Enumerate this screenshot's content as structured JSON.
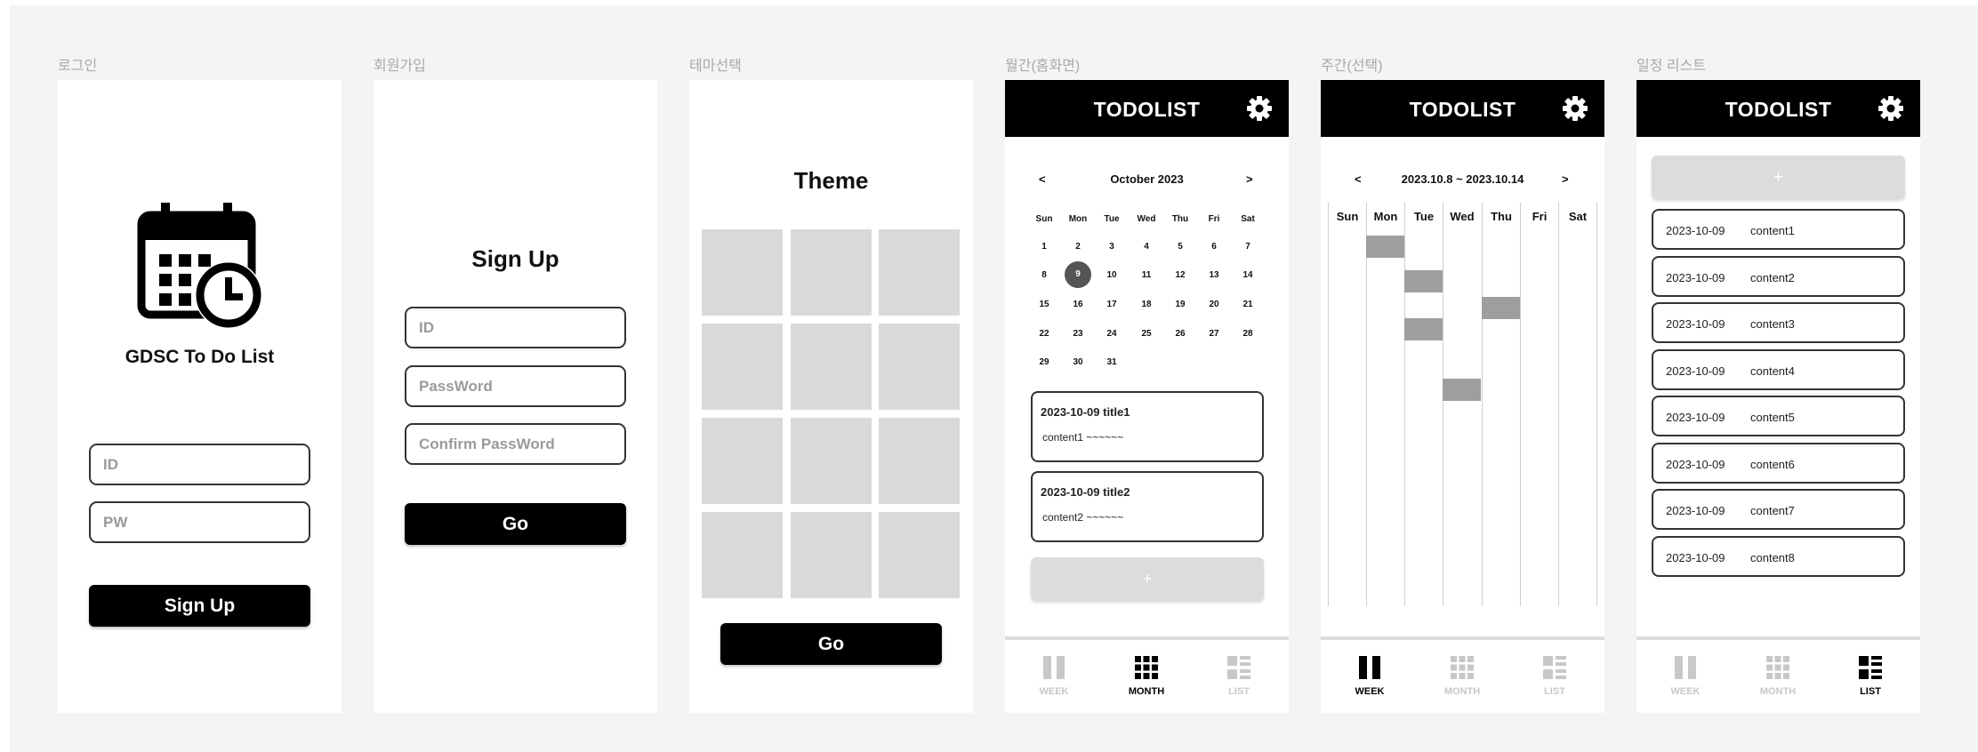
{
  "screens": {
    "login": {
      "label": "로그인",
      "app_name": "GDSC To Do List",
      "id_placeholder": "ID",
      "pw_placeholder": "PW",
      "signup_button": "Sign Up"
    },
    "signup": {
      "label": "회원가입",
      "title": "Sign Up",
      "id_placeholder": "ID",
      "password_placeholder": "PassWord",
      "confirm_placeholder": "Confirm PassWord",
      "go_button": "Go"
    },
    "theme": {
      "label": "테마선택",
      "title": "Theme",
      "go_button": "Go"
    },
    "monthly": {
      "label": "월간(홈화면)",
      "header_title": "TODOLIST",
      "prev": "<",
      "next": ">",
      "month_title": "October 2023",
      "weekdays": [
        "Sun",
        "Mon",
        "Tue",
        "Wed",
        "Thu",
        "Fri",
        "Sat"
      ],
      "weeks": [
        [
          "1",
          "2",
          "3",
          "4",
          "5",
          "6",
          "7"
        ],
        [
          "8",
          "9",
          "10",
          "11",
          "12",
          "13",
          "14"
        ],
        [
          "15",
          "16",
          "17",
          "18",
          "19",
          "20",
          "21"
        ],
        [
          "22",
          "23",
          "24",
          "25",
          "26",
          "27",
          "28"
        ],
        [
          "29",
          "30",
          "31",
          "",
          "",
          "",
          ""
        ]
      ],
      "selected_day": "9",
      "cards": [
        {
          "title": "2023-10-09  title1",
          "content": "content1 ~~~~~~"
        },
        {
          "title": "2023-10-09  title2",
          "content": "content2 ~~~~~~"
        }
      ],
      "add_label": "+"
    },
    "weekly": {
      "label": "주간(선택)",
      "header_title": "TODOLIST",
      "prev": "<",
      "next": ">",
      "range_title": "2023.10.8 ~ 2023.10.14",
      "weekdays": [
        "Sun",
        "Mon",
        "Tue",
        "Wed",
        "Thu",
        "Fri",
        "Sat"
      ]
    },
    "list": {
      "label": "일정 리스트",
      "header_title": "TODOLIST",
      "add_label": "+",
      "items": [
        {
          "date": "2023-10-09",
          "content": "content1"
        },
        {
          "date": "2023-10-09",
          "content": "content2"
        },
        {
          "date": "2023-10-09",
          "content": "content3"
        },
        {
          "date": "2023-10-09",
          "content": "content4"
        },
        {
          "date": "2023-10-09",
          "content": "content5"
        },
        {
          "date": "2023-10-09",
          "content": "content6"
        },
        {
          "date": "2023-10-09",
          "content": "content7"
        },
        {
          "date": "2023-10-09",
          "content": "content8"
        }
      ]
    }
  },
  "nav": {
    "week": "WEEK",
    "month": "MONTH",
    "list": "LIST",
    "active_by_screen": {
      "monthly": "month",
      "weekly": "week",
      "list": "list"
    }
  },
  "colors": {
    "canvas": "#f4f4f4",
    "frame": "#ffffff",
    "primary": "#000000",
    "placeholder_block": "#d9d9d9",
    "event_bar": "#9e9e9e",
    "inactive": "#c8c8c8"
  },
  "icons": {
    "app_logo": "calendar-clock-icon",
    "settings": "gear-icon",
    "week_tab": "week-columns-icon",
    "month_tab": "month-grid-icon",
    "list_tab": "list-icon"
  }
}
